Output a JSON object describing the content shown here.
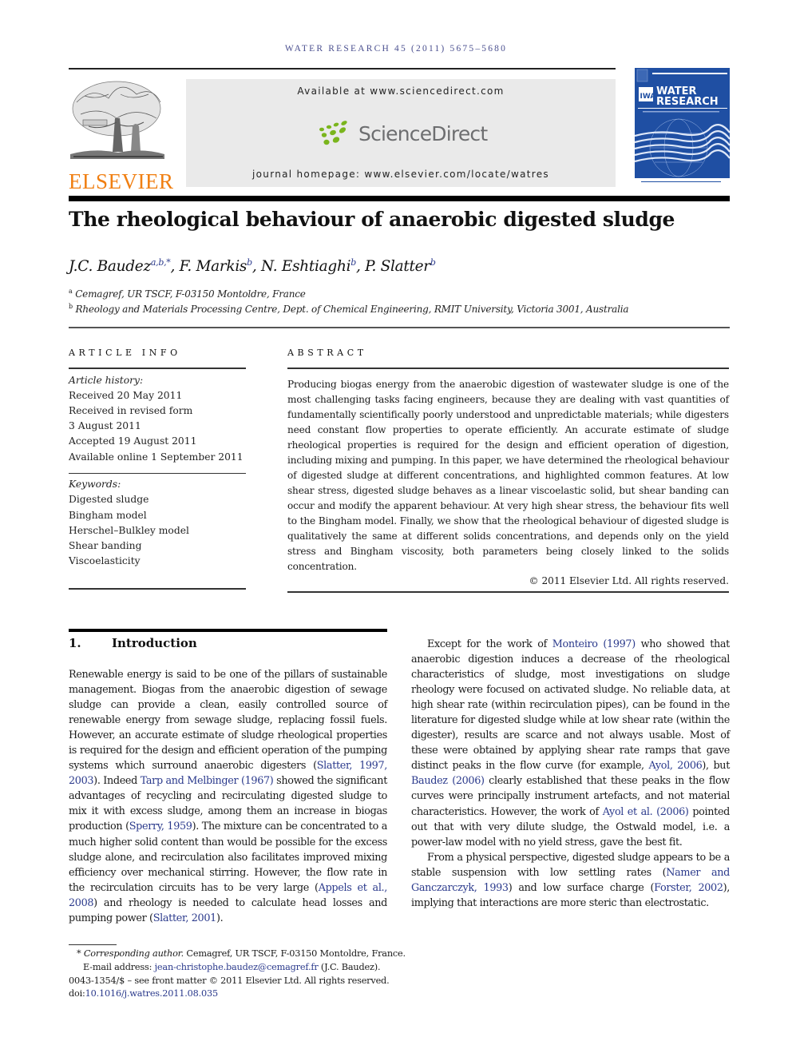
{
  "running_head": "WATER RESEARCH 45 (2011) 5675–5680",
  "publisher": {
    "logo_word": "ELSEVIER",
    "logo_color": "#f07f12"
  },
  "sciencedirect": {
    "available_text": "Available at www.sciencedirect.com",
    "logo_word": "ScienceDirect",
    "logo_dot_color": "#7ab51d",
    "homepage_text": "journal homepage: www.elsevier.com/locate/watres"
  },
  "journal_cover": {
    "line1": "WATER",
    "line2": "RESEARCH",
    "badge": "IWA",
    "color": "#1f4fa3"
  },
  "article": {
    "title": "The rheological behaviour of anaerobic digested sludge",
    "authors": [
      {
        "name": "J.C. Baudez",
        "sup": "a,b,*",
        "sep": ", "
      },
      {
        "name": "F. Markis",
        "sup": "b",
        "sep": ", "
      },
      {
        "name": "N. Eshtiaghi",
        "sup": "b",
        "sep": ", "
      },
      {
        "name": "P. Slatter",
        "sup": "b",
        "sep": ""
      }
    ],
    "affiliations": [
      {
        "mark": "a",
        "text": "Cemagref, UR TSCF, F-03150 Montoldre, France"
      },
      {
        "mark": "b",
        "text": "Rheology and Materials Processing Centre, Dept. of Chemical Engineering, RMIT University, Victoria 3001, Australia"
      }
    ]
  },
  "article_info": {
    "heading": "ARTICLE INFO",
    "history_label": "Article history:",
    "history": [
      "Received 20 May 2011",
      "Received in revised form",
      "3 August 2011",
      "Accepted 19 August 2011",
      "Available online 1 September 2011"
    ],
    "keywords_label": "Keywords:",
    "keywords": [
      "Digested sludge",
      "Bingham model",
      "Herschel–Bulkley model",
      "Shear banding",
      "Viscoelasticity"
    ]
  },
  "abstract": {
    "heading": "ABSTRACT",
    "text": "Producing biogas energy from the anaerobic digestion of wastewater sludge is one of the most challenging tasks facing engineers, because they are dealing with vast quantities of fundamentally scientifically poorly understood and unpredictable materials; while digesters need constant flow properties to operate efficiently. An accurate estimate of sludge rheological properties is required for the design and efficient operation of digestion, including mixing and pumping. In this paper, we have determined the rheological behaviour of digested sludge at different concentrations, and highlighted common features. At low shear stress, digested sludge behaves as a linear viscoelastic solid, but shear banding can occur and modify the apparent behaviour. At very high shear stress, the behaviour fits well to the Bingham model. Finally, we show that the rheological behaviour of digested sludge is qualitatively the same at different solids concentrations, and depends only on the yield stress and Bingham viscosity, both parameters being closely linked to the solids concentration.",
    "copyright": "© 2011 Elsevier Ltd. All rights reserved."
  },
  "introduction": {
    "number": "1.",
    "title": "Introduction",
    "left_paragraph": [
      {
        "t": "Renewable energy is said to be one of the pillars of sustainable management. Biogas from the anaerobic digestion of sewage sludge can provide a clean, easily controlled source of renewable energy from sewage sludge, replacing fossil fuels. However, an accurate estimate of sludge rheological proper­ties is required for the design and efficient operation of the pumping systems which surround anaerobic digesters ("
      },
      {
        "t": "Slatter, 1997, 2003",
        "link": true
      },
      {
        "t": "). Indeed "
      },
      {
        "t": "Tarp and Melbinger (1967)",
        "link": true
      },
      {
        "t": " showed the significant advantages of recycling and recirculating digested sludge to mix it with excess sludge, among them an increase in biogas production ("
      },
      {
        "t": "Sperry, 1959",
        "link": true
      },
      {
        "t": "). The mixture can be concentrated to a much higher solid content than would be possible for the excess sludge alone, and recirculation also facilitates improved mixing efficiency over mechanical stir­ring. However, the flow rate in the recirculation circuits has to be very large ("
      },
      {
        "t": "Appels et al., 2008",
        "link": true
      },
      {
        "t": ") and rheology is needed to calculate head losses and pumping power ("
      },
      {
        "t": "Slatter, 2001",
        "link": true
      },
      {
        "t": ")."
      }
    ],
    "right_paragraph_1": [
      {
        "t": "Except for the work of "
      },
      {
        "t": "Monteiro (1997)",
        "link": true
      },
      {
        "t": " who showed that anaerobic digestion induces a decrease of the rheological characteristics of sludge, most investigations on sludge rheology were focused on activated sludge. No reliable data, at high shear rate (within recirculation pipes), can be found in the literature for digested sludge while at low shear rate (within the digester), results are scarce and not always usable. Most of these were obtained by applying shear rate ramps that gave distinct peaks in the flow curve (for example, "
      },
      {
        "t": "Ayol, 2006",
        "link": true
      },
      {
        "t": "), but "
      },
      {
        "t": "Baudez (2006)",
        "link": true
      },
      {
        "t": " clearly established that these peaks in the flow curves were principally instrument artefacts, and not material characteristics. However, the work of "
      },
      {
        "t": "Ayol et al. (2006)",
        "link": true
      },
      {
        "t": " pointed out that with very dilute sludge, the Ostwald model, i.e. a power-law model with no yield stress, gave the best fit."
      }
    ],
    "right_paragraph_2": [
      {
        "t": "From a physical perspective, digested sludge appears to be a stable suspension with low settling rates ("
      },
      {
        "t": "Namer and Ganczarczyk, 1993",
        "link": true
      },
      {
        "t": ") and low surface charge ("
      },
      {
        "t": "Forster, 2002",
        "link": true
      },
      {
        "t": "), implying that interactions are more steric than electrostatic."
      }
    ]
  },
  "footnotes": {
    "star": "*",
    "corresponding_label": "Corresponding author.",
    "corresponding_text": " Cemagref, UR TSCF, F-03150 Montoldre, France.",
    "email_label": "E-mail address: ",
    "email": "jean-christophe.baudez@cemagref.fr",
    "email_suffix": " (J.C. Baudez).",
    "issn_line": "0043-1354/$ – see front matter © 2011 Elsevier Ltd. All rights reserved.",
    "doi_label": "doi:",
    "doi": "10.1016/j.watres.2011.08.035"
  }
}
